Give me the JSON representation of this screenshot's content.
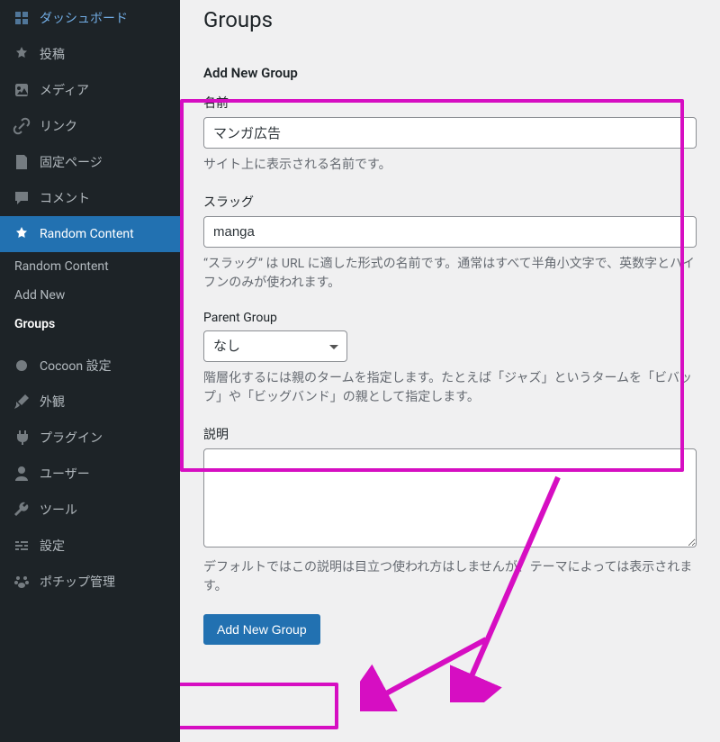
{
  "sidebar": {
    "items": [
      {
        "label": "ダッシュボード"
      },
      {
        "label": "投稿"
      },
      {
        "label": "メディア"
      },
      {
        "label": "リンク"
      },
      {
        "label": "固定ページ"
      },
      {
        "label": "コメント"
      },
      {
        "label": "Random Content"
      }
    ],
    "submenu": [
      {
        "label": "Random Content"
      },
      {
        "label": "Add New"
      },
      {
        "label": "Groups"
      }
    ],
    "items2": [
      {
        "label": "Cocoon 設定"
      },
      {
        "label": "外観"
      },
      {
        "label": "プラグイン"
      },
      {
        "label": "ユーザー"
      },
      {
        "label": "ツール"
      },
      {
        "label": "設定"
      },
      {
        "label": "ポチップ管理"
      }
    ]
  },
  "page": {
    "title": "Groups",
    "section_title": "Add New Group",
    "name_label": "名前",
    "name_value": "マンガ広告",
    "name_help": "サイト上に表示される名前です。",
    "slug_label": "スラッグ",
    "slug_value": "manga",
    "slug_help": "“スラッグ” は URL に適した形式の名前です。通常はすべて半角小文字で、英数字とハイフンのみが使われます。",
    "parent_label": "Parent Group",
    "parent_selected": "なし",
    "parent_help": "階層化するには親のタームを指定します。たとえば「ジャズ」というタームを「ビバップ」や「ビッグバンド」の親として指定します。",
    "desc_label": "説明",
    "desc_value": "",
    "desc_help": "デフォルトではこの説明は目立つ使われ方はしませんが、テーマによっては表示されます。",
    "submit_label": "Add New Group"
  }
}
